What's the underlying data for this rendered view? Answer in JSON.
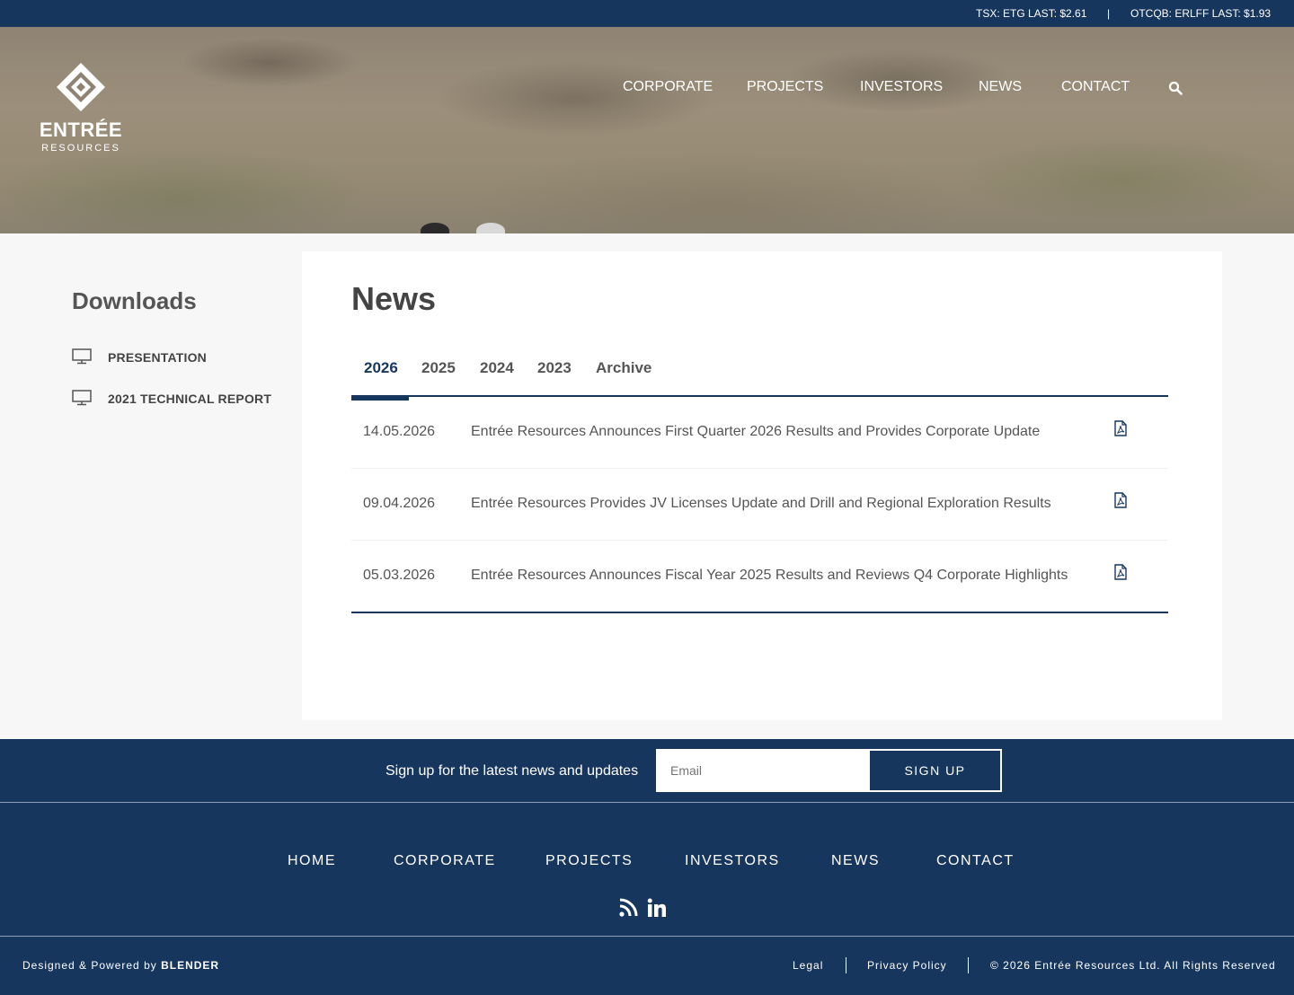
{
  "ticker": {
    "tsx": "TSX: ETG   LAST: $2.61",
    "separator": "|",
    "otc": "OTCQB: ERLFF   LAST: $1.93"
  },
  "logo": {
    "brand": "ENTRÉE",
    "sub": "RESOURCES"
  },
  "nav": {
    "items": [
      "CORPORATE",
      "PROJECTS",
      "INVESTORS",
      "NEWS",
      "CONTACT"
    ],
    "search_icon": "search-icon"
  },
  "sidebar": {
    "title": "Downloads",
    "items": [
      {
        "label": "PRESENTATION",
        "icon": "monitor-icon"
      },
      {
        "label": "2021 TECHNICAL REPORT",
        "icon": "monitor-icon"
      }
    ]
  },
  "main": {
    "title": "News",
    "tabs": [
      "2026",
      "2025",
      "2024",
      "2023",
      "Archive"
    ],
    "active_tab": "2026",
    "rows": [
      {
        "date": "14.05.2026",
        "title": "Entrée Resources Announces First Quarter 2026 Results and Provides Corporate Update",
        "icon": "pdf-icon"
      },
      {
        "date": "09.04.2026",
        "title": "Entrée Resources Provides JV Licenses Update and Drill and Regional Exploration Results",
        "icon": "pdf-icon"
      },
      {
        "date": "05.03.2026",
        "title": "Entrée Resources Announces Fiscal Year 2025 Results and Reviews Q4 Corporate Highlights",
        "icon": "pdf-icon"
      }
    ]
  },
  "signup": {
    "label": "Sign up for the latest news and updates",
    "placeholder": "Email",
    "button": "SIGN UP"
  },
  "footer": {
    "nav": [
      "HOME",
      "CORPORATE",
      "PROJECTS",
      "INVESTORS",
      "NEWS",
      "CONTACT"
    ],
    "social": [
      "rss-icon",
      "linkedin-icon"
    ],
    "designed_prefix": "Designed & Powered by",
    "designed_by": "BLENDER",
    "legal": "Legal",
    "privacy": "Privacy Policy",
    "copyright": "© 2026 Entrée Resources Ltd. All Rights Reserved"
  },
  "colors": {
    "brand_navy": "#17365d",
    "page_bg": "#f7f7f7",
    "card_bg": "#ffffff"
  }
}
